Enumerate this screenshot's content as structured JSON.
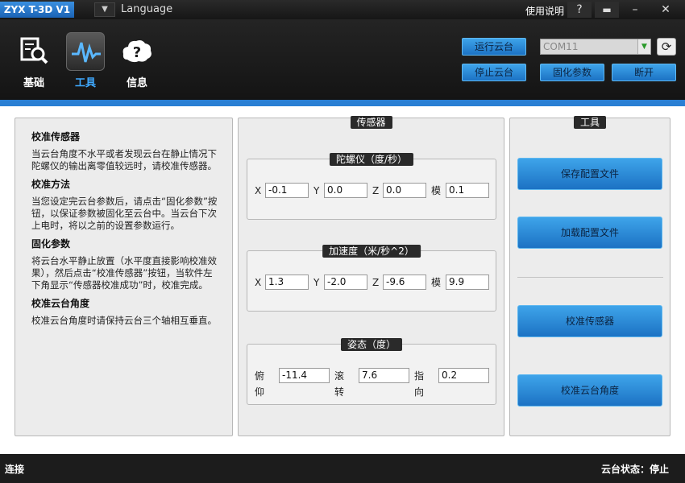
{
  "app": {
    "title": "ZYX T-3D V1",
    "language_label": "Language",
    "help_label": "使用说明"
  },
  "nav": [
    {
      "label": "基础",
      "icon": "search-document-icon"
    },
    {
      "label": "工具",
      "icon": "waveform-icon",
      "active": true
    },
    {
      "label": "信息",
      "icon": "question-cloud-icon"
    }
  ],
  "controls": {
    "run_label": "运行云台",
    "stop_label": "停止云台",
    "fix_params_label": "固化参数",
    "disconnect_label": "断开",
    "com_port": "COM11"
  },
  "info": {
    "sections": [
      {
        "heading": "校准传感器",
        "text": "当云台角度不水平或者发现云台在静止情况下陀螺仪的输出离零值较远时，请校准传感器。"
      },
      {
        "heading": "校准方法",
        "text": "当您设定完云台参数后，请点击“固化参数”按钮，以保证参数被固化至云台中。当云台下次上电时，将以之前的设置参数运行。"
      },
      {
        "heading": "固化参数",
        "text": "将云台水平静止放置（水平度直接影响校准效果），然后点击“校准传感器”按钮，当软件左下角显示“传感器校准成功”时，校准完成。"
      },
      {
        "heading": "校准云台角度",
        "text": "校准云台角度时请保持云台三个轴相互垂直。"
      }
    ]
  },
  "sensor": {
    "title": "传感器",
    "gyro": {
      "title": "陀螺仪（度/秒）",
      "labels": [
        "X",
        "Y",
        "Z",
        "模"
      ],
      "values": [
        "-0.1",
        "0.0",
        "0.0",
        "0.1"
      ]
    },
    "accel": {
      "title": "加速度（米/秒^2）",
      "labels": [
        "X",
        "Y",
        "Z",
        "模"
      ],
      "values": [
        "1.3",
        "-2.0",
        "-9.6",
        "9.9"
      ]
    },
    "attitude": {
      "title": "姿态（度）",
      "labels": [
        "俯仰",
        "滚转",
        "指向"
      ],
      "values": [
        "-11.4",
        "7.6",
        "0.2"
      ]
    }
  },
  "tools": {
    "title": "工具",
    "save_config": "保存配置文件",
    "load_config": "加载配置文件",
    "calibrate_sensor": "校准传感器",
    "calibrate_angle": "校准云台角度"
  },
  "status": {
    "connection": "连接",
    "gimbal_status": "云台状态：停止"
  },
  "colors": {
    "accent": "#2a7fd4",
    "button_blue": "#2f8fdc"
  }
}
